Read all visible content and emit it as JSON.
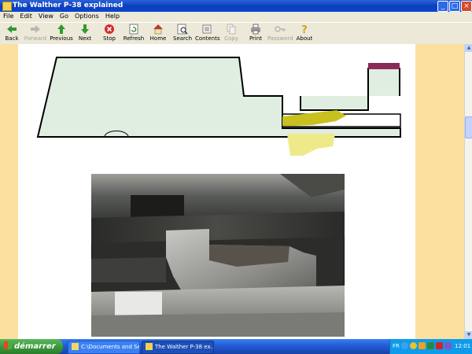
{
  "window": {
    "title": "The Walther P-38 explained",
    "controls": {
      "minimize": "_",
      "maximize": "□",
      "close": "×"
    }
  },
  "menu": [
    "File",
    "Edit",
    "View",
    "Go",
    "Options",
    "Help"
  ],
  "toolbar": [
    {
      "label": "Back",
      "icon": "back-arrow-icon",
      "enabled": true
    },
    {
      "label": "Forward",
      "icon": "forward-arrow-icon",
      "enabled": false
    },
    {
      "label": "Previous",
      "icon": "up-arrow-icon",
      "enabled": true
    },
    {
      "label": "Next",
      "icon": "down-arrow-icon",
      "enabled": true
    },
    {
      "label": "Stop",
      "icon": "stop-icon",
      "enabled": true
    },
    {
      "label": "Refresh",
      "icon": "refresh-icon",
      "enabled": true
    },
    {
      "label": "Home",
      "icon": "home-icon",
      "enabled": true
    },
    {
      "label": "Search",
      "icon": "search-icon",
      "enabled": true
    },
    {
      "label": "Contents",
      "icon": "contents-icon",
      "enabled": true
    },
    {
      "label": "Copy",
      "icon": "copy-icon",
      "enabled": false
    },
    {
      "label": "Print",
      "icon": "print-icon",
      "enabled": true
    },
    {
      "label": "Password",
      "icon": "key-icon",
      "enabled": false
    },
    {
      "label": "About",
      "icon": "question-icon",
      "enabled": true
    }
  ],
  "colors": {
    "part_fill": "#dfeee0",
    "locking_block": "#c8c01e",
    "locking_block_light": "#eeea8a",
    "rear_sight": "#8b2a58",
    "page_margin": "#fbe0a0"
  },
  "content": {
    "diagram": {
      "subject": "slide-and-locking-block-diagram"
    },
    "photo": {
      "subject": "locking-block-photo"
    }
  },
  "taskbar": {
    "start_label": "démarrer",
    "tasks": [
      {
        "label": "C:\\Documents and Se...",
        "active": false
      },
      {
        "label": "The Walther P-38 ex...",
        "active": true
      }
    ],
    "language": "FR",
    "clock": "12:01"
  }
}
